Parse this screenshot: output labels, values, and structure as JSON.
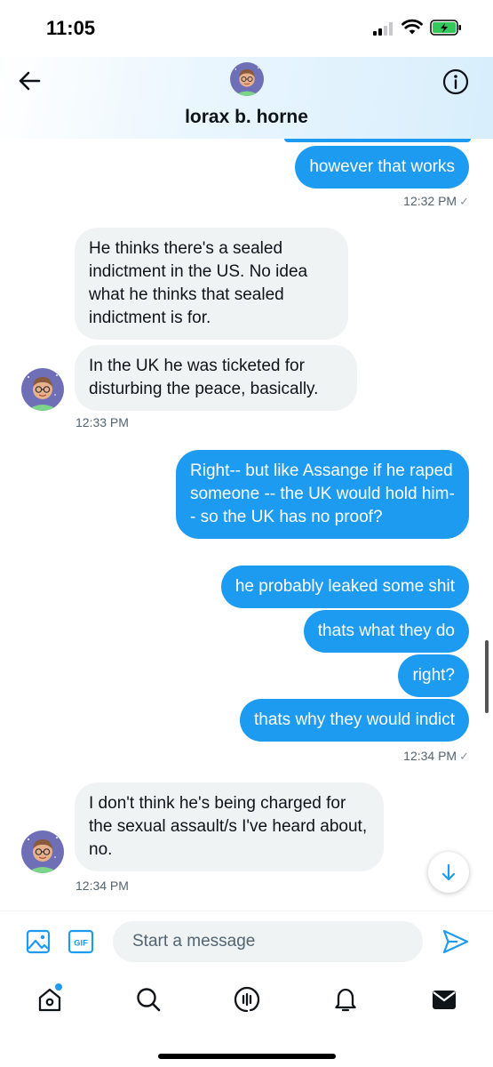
{
  "status_bar": {
    "time": "11:05"
  },
  "header": {
    "contact_name": "lorax b. horne"
  },
  "messages": {
    "m1": "however that works",
    "t1": "12:32 PM",
    "m2": "He thinks there's a sealed indictment in the US. No idea what he thinks that sealed indictment is for.",
    "m3": "In the UK he was ticketed for disturbing the peace, basically.",
    "t2": "12:33 PM",
    "m4": "Right-- but like Assange if he raped someone -- the UK would hold him-- so the UK has no proof?",
    "m5": "he probably leaked some shit",
    "m6": "thats what they do",
    "m7": "right?",
    "m8": "thats why they would indict",
    "t3": "12:34 PM",
    "m9": "I don't think he's being charged for the sexual assault/s I've heard about, no.",
    "t4": "12:34 PM",
    "read_mark": "✓"
  },
  "composer": {
    "placeholder": "Start a message",
    "gif_label": "GIF"
  },
  "tabs": [
    "home-icon",
    "search-icon",
    "spaces-icon",
    "notifications-icon",
    "messages-icon"
  ],
  "colors": {
    "accent": "#1d9bf0",
    "incoming_bubble": "#eff3f4",
    "muted_text": "#536471"
  }
}
